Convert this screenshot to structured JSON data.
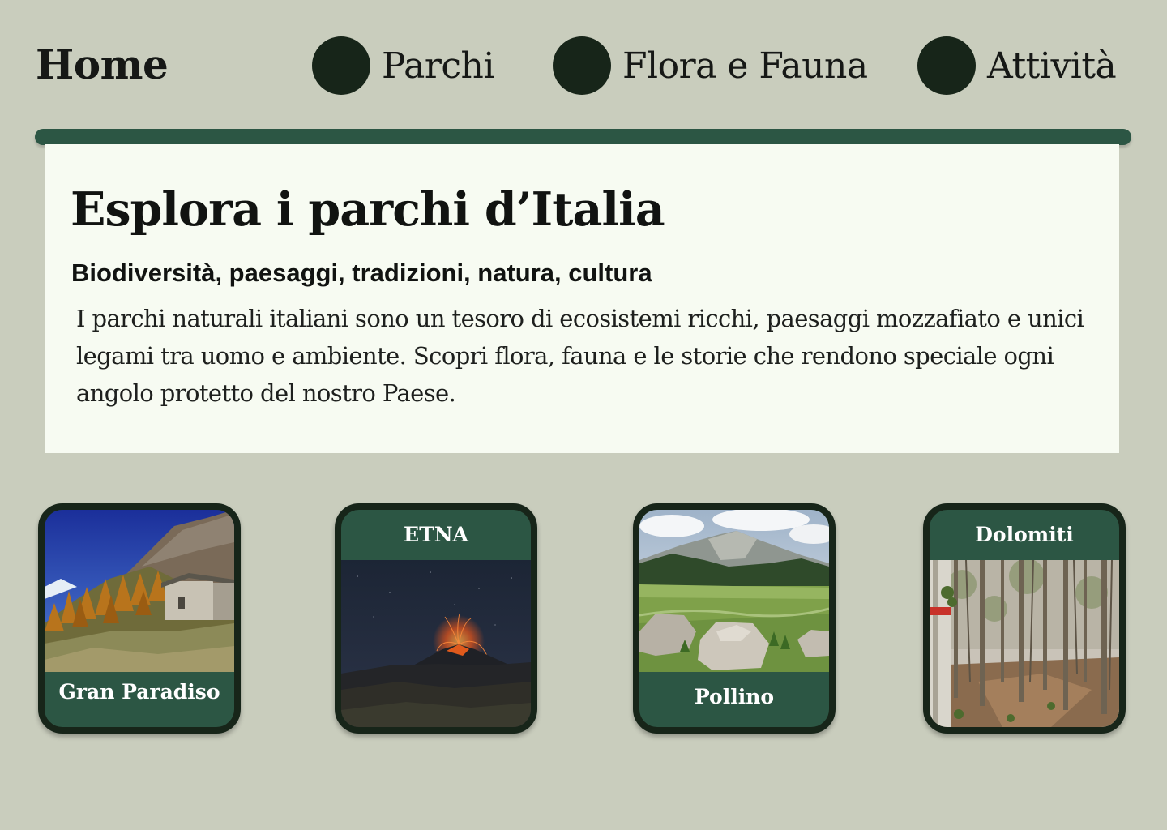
{
  "nav": {
    "home": "Home",
    "items": [
      {
        "label": "Parchi"
      },
      {
        "label": "Flora e Fauna"
      },
      {
        "label": "Attività"
      }
    ]
  },
  "hero": {
    "title": "Esplora i parchi d’Italia",
    "subtitle": "Biodiversità, paesaggi, tradizioni, natura, cultura",
    "text": "I parchi naturali italiani sono un tesoro di ecosistemi ricchi, paesaggi mozzafiato e unici legami tra uomo e ambiente. Scopri flora, fauna e le storie che rendono speciale ogni angolo protetto del nostro Paese."
  },
  "parks": [
    {
      "name": "Gran Paradiso"
    },
    {
      "name": "ETNA"
    },
    {
      "name": "Pollino"
    },
    {
      "name": "Dolomiti"
    }
  ],
  "colors": {
    "page_background": "#c9cdbd",
    "accent_green": "#2c5644",
    "dark_green": "#172519",
    "card_background": "#f7fbf2"
  }
}
